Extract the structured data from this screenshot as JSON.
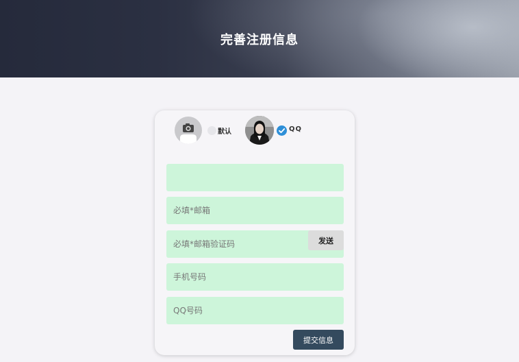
{
  "header": {
    "title": "完善注册信息"
  },
  "avatar_options": {
    "default_label": "默认",
    "qq_label": "QQ",
    "default_icon": "camera-icon",
    "qq_selected_icon": "check-icon",
    "selected": "qq"
  },
  "form": {
    "field1": {
      "value": "",
      "placeholder": ""
    },
    "email": {
      "placeholder": "必填*邮箱"
    },
    "email_code": {
      "placeholder": "必填*邮箱验证码"
    },
    "phone": {
      "placeholder": "手机号码"
    },
    "qq_number": {
      "placeholder": "QQ号码"
    },
    "send_label": "发送",
    "submit_label": "提交信息"
  },
  "colors": {
    "field_bg": "#cdf5da",
    "submit_bg": "#344a5e",
    "check_blue": "#2e8fd8"
  }
}
